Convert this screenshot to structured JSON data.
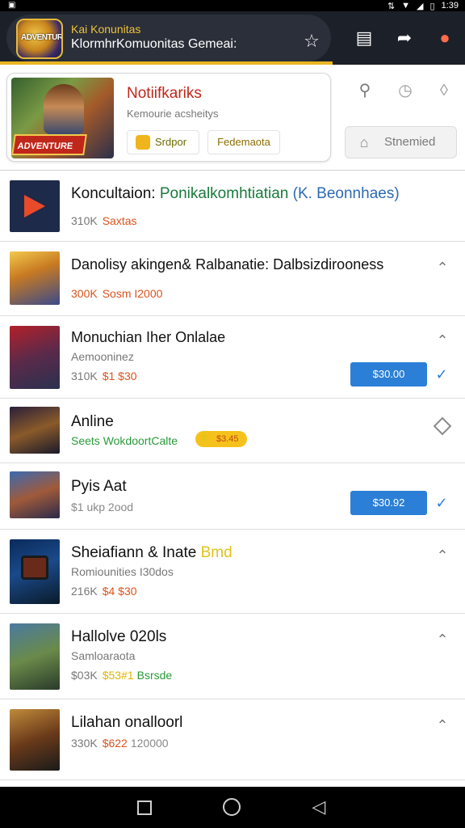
{
  "status_bar": {
    "time": "1:39"
  },
  "app_bar": {
    "logo_text": "ADVENTURE",
    "title_line1": "Kai Konunitas",
    "title_line2": "KlormhrKomuonitas Gemeai:",
    "icons": [
      "star-icon",
      "document-icon",
      "share-icon",
      "notification-icon"
    ]
  },
  "featured": {
    "title": "Notiifkariks",
    "subtitle": "Kemourie acsheitys",
    "thumb_banner": "ADVENTURE",
    "button_1": "Srdpor",
    "button_2": "Fedemaota"
  },
  "side": {
    "icons": [
      "search-icon",
      "clock-icon",
      "tag-icon"
    ],
    "button_label": "Stnemied"
  },
  "list": [
    {
      "title_plain": "Koncultaion: ",
      "title_green": "Ponikalkomhtiatian",
      "title_blue": " (K. Beonnhaes)",
      "meta_count": "310K",
      "meta_price": "Saxtas"
    },
    {
      "title": "Danolisy akingen& Ralbanatie: Dalbsizdirooness",
      "meta_count": "300K",
      "meta_price": "Sosm I2000"
    },
    {
      "title": "Monuchian Iher Onlalae",
      "subtitle": "Aemooninez",
      "meta_count": "310K",
      "meta_price": "$1 $30",
      "button": "$30.00"
    },
    {
      "title": "Anline",
      "meta_green": "Seets WokdoortCalte",
      "badge": "$3.45"
    },
    {
      "title": "Pyis Aat",
      "meta_gray": "$1 ukp 2ood",
      "button": "$30.92"
    },
    {
      "title_plain": "Sheiafiann & Inate ",
      "title_yellow": "Bmd",
      "subtitle": "Romiounities I30dos",
      "meta_count": "216K",
      "meta_price": "$4 $30"
    },
    {
      "title": "Hallolve 020ls",
      "subtitle": "Samloaraota",
      "meta_count": "$03K",
      "meta_price": "$53#1",
      "meta_extra": "Bsrsde"
    },
    {
      "title": "Lilahan onalloorl",
      "meta_count": "330K",
      "meta_price": "$622",
      "meta_gray": "120000"
    }
  ],
  "colors": {
    "app_bar_bg": "#1c2028",
    "accent_gold": "#e8b622",
    "price_orange": "#d9531c",
    "buy_blue": "#2b7fd6"
  }
}
